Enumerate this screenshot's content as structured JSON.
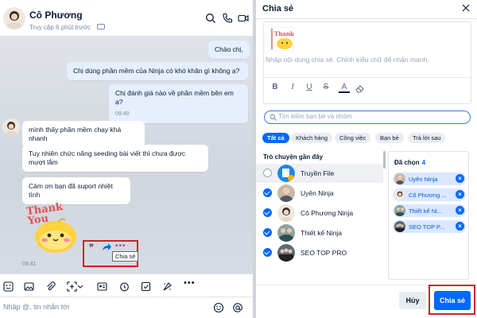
{
  "chat": {
    "contact_name": "Cô Phương",
    "status": "Truy cập 6 phút trước",
    "messages": [
      {
        "text": "Chào chị,"
      },
      {
        "text": "Chị dùng phần mềm của Ninja có khó khăn gì không ạ?"
      },
      {
        "text": "Chị đánh giá nào về phần mềm bên em ạ?",
        "time": "09:40"
      },
      {
        "text": "mình thấy phần mềm chạy khá nhanh"
      },
      {
        "text": "Tuy nhiên chức năng seeding bài viết thì chưa được mượt lắm"
      },
      {
        "text": "Cảm ơn bạn đã suport nhiệt tình"
      }
    ],
    "sticker_text_line1": "Thank",
    "sticker_text_line2": "You",
    "sticker_time": "09:41",
    "tooltip": "Chia sẻ",
    "input_placeholder": "Nhập @, tin nhắn tới"
  },
  "share_dialog": {
    "title": "Chia sẻ",
    "compose_placeholder": "Nhập nội dung chia sẻ. Chỉnh kiểu chữ để nhấn mạnh.",
    "search_placeholder": "Tìm kiếm bạn bè và nhóm",
    "filters": [
      {
        "label": "Tất cả",
        "active": true
      },
      {
        "label": "Khách hàng",
        "active": false
      },
      {
        "label": "Công việc",
        "active": false
      },
      {
        "label": "Bạn bè",
        "active": false
      },
      {
        "label": "Trả lời sau",
        "active": false
      }
    ],
    "recent_label": "Trò chuyện gần đây",
    "contacts": [
      {
        "name": "Truyền File",
        "checked": false
      },
      {
        "name": "Uyên Ninja",
        "checked": true
      },
      {
        "name": "Cô Phương Ninja",
        "checked": true
      },
      {
        "name": "Thiết kế Ninja",
        "checked": true
      },
      {
        "name": "SEO TOP PRO",
        "checked": true
      }
    ],
    "selected_label": "Đã chọn",
    "selected_count": "4",
    "selected": [
      {
        "name": "Uyên Ninja"
      },
      {
        "name": "Cô Phương ..."
      },
      {
        "name": "Thiết kế Ni..."
      },
      {
        "name": "SEO TOP P..."
      }
    ],
    "cancel_label": "Hủy",
    "share_label": "Chia sẻ"
  },
  "colors": {
    "accent": "#0068ff",
    "highlight_frame": "#d0212a",
    "chat_background": "#cfd6de"
  }
}
